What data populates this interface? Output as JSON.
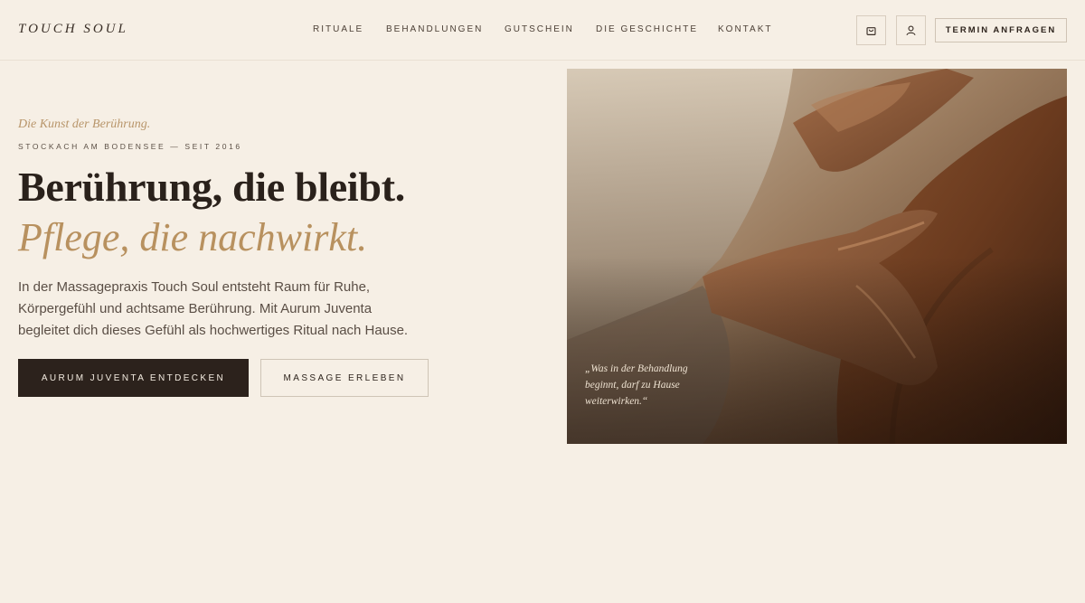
{
  "header": {
    "logo": "TOUCH SOUL",
    "nav": [
      "RITUALE",
      "BEHANDLUNGEN",
      "GUTSCHEIN",
      "DIE GESCHICHTE",
      "KONTAKT"
    ],
    "cart_icon": "shopping-bag-icon",
    "account_icon": "user-icon",
    "cta_label": "TERMIN ANFRAGEN"
  },
  "hero": {
    "kicker": "Die Kunst der Berührung.",
    "location": "STOCKACH AM BODENSEE — SEIT 2016",
    "headline": "Berührung, die bleibt.",
    "headline_accent": "Pflege, die nachwirkt.",
    "description": "In der Massagepraxis Touch Soul entsteht Raum für Ruhe, Körpergefühl und achtsame Berührung. Mit Aurum Juventa begleitet dich dieses Gefühl als hochwertiges Ritual nach Hause.",
    "primary_button": "AURUM JUVENTA ENTDECKEN",
    "secondary_button": "MASSAGE ERLEBEN",
    "quote": "„Was in der Behandlung beginnt, darf zu Hause weiterwirken.“"
  },
  "colors": {
    "background": "#f6efe5",
    "accent_gold": "#b8915f",
    "dark": "#2c221c"
  }
}
